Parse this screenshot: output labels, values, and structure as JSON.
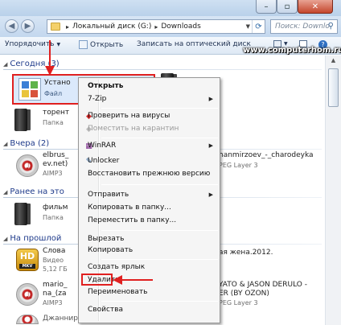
{
  "window": {
    "title_icon": "explorer-folder-icon",
    "controls": {
      "minimize": "–",
      "maximize": "▫",
      "close": "✕"
    }
  },
  "address_bar": {
    "segments": [
      "Локальный диск (G:)",
      "Downloads"
    ],
    "search_placeholder": "Поиск: Downlo"
  },
  "toolbar": {
    "organize": "Упорядочить",
    "open": "Открыть",
    "burn": "Записать на оптический диск"
  },
  "watermark": "www.computerhom.ru",
  "groups": [
    {
      "label": "Сегодня (3)"
    },
    {
      "label": "Вчера (2)"
    },
    {
      "label": "Ранее на это"
    },
    {
      "label": "На прошлой"
    }
  ],
  "files": {
    "setup": {
      "name": "Устано",
      "meta": "Файл"
    },
    "torrent": {
      "name": "торент",
      "meta": "Папка"
    },
    "elbrus": {
      "name": "elbrus_",
      "name2": "ev.net)",
      "meta": "AIMP3"
    },
    "films": {
      "name": "фильм",
      "meta": "Папка"
    },
    "slova": {
      "name": "Слова",
      "meta": "Видео",
      "meta2": "5,12 ГБ"
    },
    "mario": {
      "name": "mario_",
      "name2": "na_(za",
      "meta": "AIMP3"
    },
    "dzhan": {
      "name": "Джаннирзоев Эльбрус - Скитания"
    },
    "right_chare": {
      "name": "hanmirzoev_-_charodeyka",
      "meta": "PEG Layer 3"
    },
    "right_zhena": {
      "name": "ая жена.2012."
    },
    "right_sean": {
      "name": "YATO & JASON DERULO -",
      "name2": "ER (BY OZON)",
      "meta": "PEG Layer 3"
    }
  },
  "context_menu": {
    "items": [
      {
        "label": "Открыть",
        "bold": true
      },
      {
        "label": "7-Zip",
        "submenu": true
      },
      {
        "label": "Проверить на вирусы",
        "icon": "antivirus-icon"
      },
      {
        "label": "Поместить на карантин",
        "disabled": true,
        "icon": "quarantine-icon"
      },
      {
        "label": "WinRAR",
        "submenu": true,
        "icon": "winrar-icon"
      },
      {
        "label": "Unlocker",
        "icon": "unlocker-icon"
      },
      {
        "label": "Восстановить прежнюю версию"
      },
      {
        "label": "Отправить",
        "submenu": true
      },
      {
        "label": "Копировать в папку..."
      },
      {
        "label": "Переместить в папку..."
      },
      {
        "label": "Вырезать"
      },
      {
        "label": "Копировать"
      },
      {
        "label": "Создать ярлык"
      },
      {
        "label": "Удалить"
      },
      {
        "label": "Переименовать"
      },
      {
        "label": "Свойства"
      }
    ]
  },
  "colors": {
    "annotation": "#e02020",
    "group_header": "#1e3a8a",
    "selection": "#dbe9fb"
  }
}
